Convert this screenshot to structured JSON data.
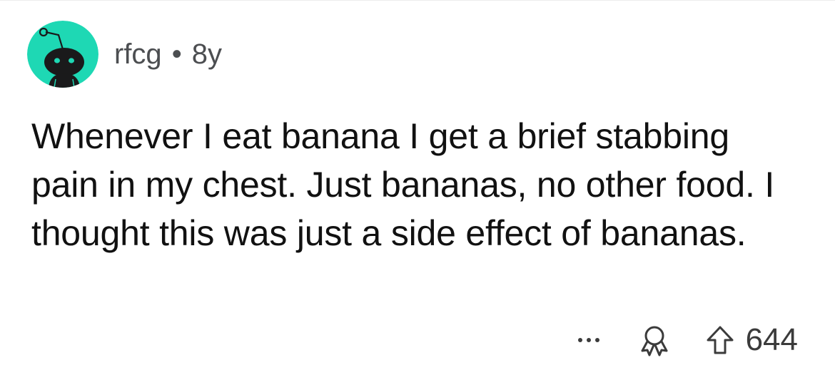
{
  "comment": {
    "author": "rfcg",
    "separator": "•",
    "age": "8y",
    "body": "Whenever I eat banana I get a brief stabbing pain in my chest. Just bananas, no other food. I thought this was just a side effect of bananas.",
    "score": "644"
  },
  "icons": {
    "avatar": "snoo-avatar-icon",
    "more": "more-options-icon",
    "award": "award-icon",
    "upvote": "upvote-arrow-icon"
  },
  "colors": {
    "avatar_background": "#1ed8b4",
    "avatar_figure": "#1a1a1b",
    "meta_text": "#4c4e51",
    "body_text": "#111111"
  }
}
